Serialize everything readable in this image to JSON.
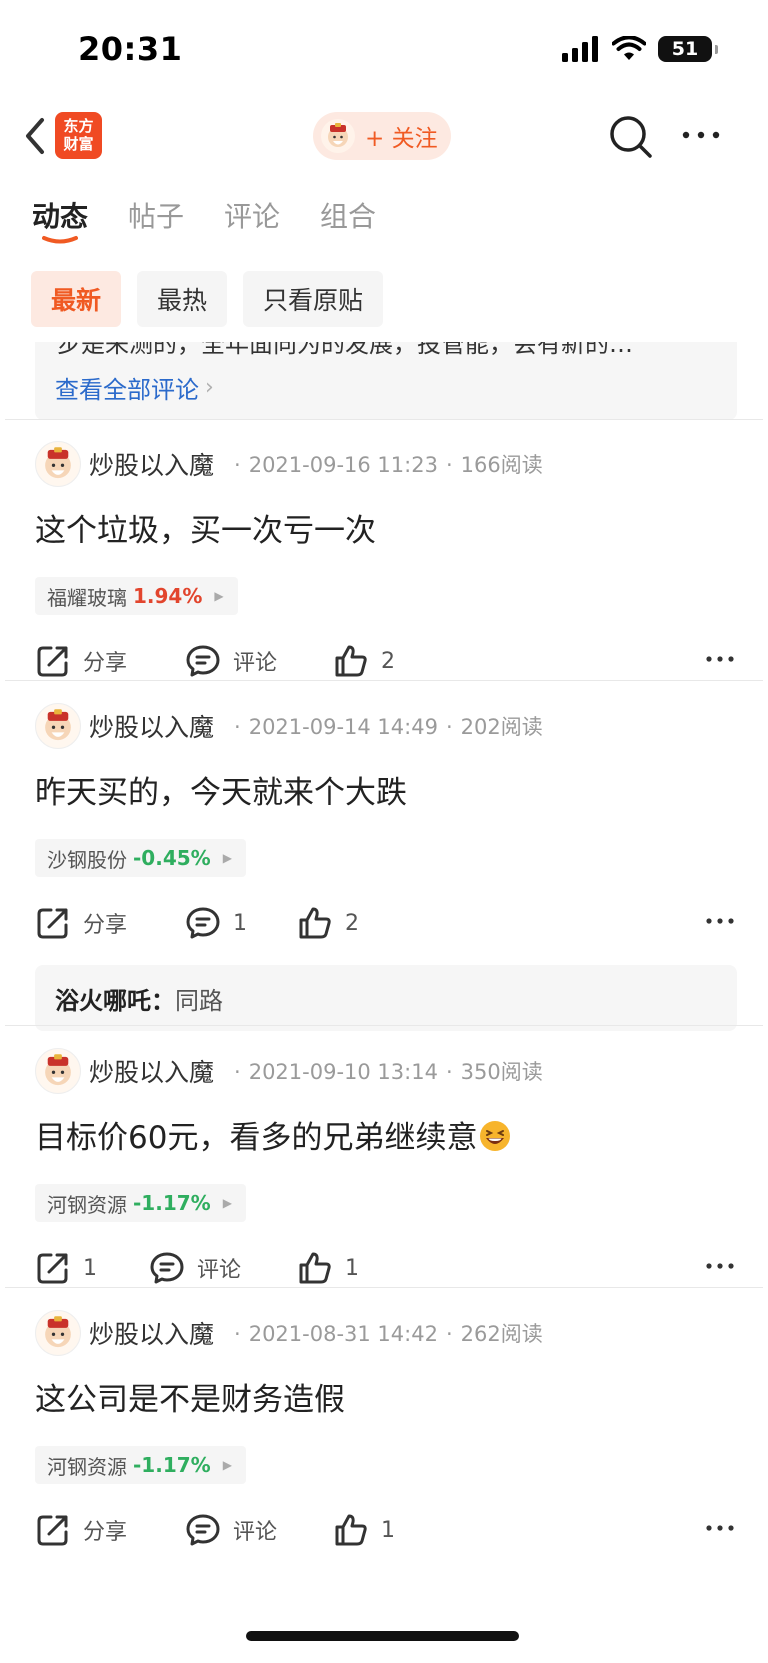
{
  "status_bar": {
    "time": "20:31",
    "battery": "51"
  },
  "nav": {
    "logo_text": "东方\n财富",
    "follow_label": "+ 关注"
  },
  "tabs": [
    {
      "label": "动态",
      "active": true
    },
    {
      "label": "帖子",
      "active": false
    },
    {
      "label": "评论",
      "active": false
    },
    {
      "label": "组合",
      "active": false
    }
  ],
  "filters": [
    {
      "label": "最新",
      "active": true
    },
    {
      "label": "最热",
      "active": false
    },
    {
      "label": "只看原贴",
      "active": false
    }
  ],
  "prev_comment": {
    "cut_text": "步是来测的，全年面向为的发展，投管能，会有新的…",
    "view_all": "查看全部评论"
  },
  "posts": [
    {
      "author": "炒股以入魔",
      "date": "2021-09-16 11:23",
      "reads": "166阅读",
      "text": "这个垃圾，买一次亏一次",
      "stock": {
        "name": "福耀玻璃",
        "change": "1.94%",
        "direction": "up"
      },
      "share": "分享",
      "comment": "评论",
      "like": "2",
      "reply": null
    },
    {
      "author": "炒股以入魔",
      "date": "2021-09-14 14:49",
      "reads": "202阅读",
      "text": "昨天买的，今天就来个大跌",
      "stock": {
        "name": "沙钢股份",
        "change": "-0.45%",
        "direction": "down"
      },
      "share": "分享",
      "comment": "1",
      "like": "2",
      "reply": {
        "author": "浴火哪吒：",
        "text": "同路"
      }
    },
    {
      "author": "炒股以入魔",
      "date": "2021-09-10 13:14",
      "reads": "350阅读",
      "text": "目标价60元，看多的兄弟继续意",
      "stock": {
        "name": "河钢资源",
        "change": "-1.17%",
        "direction": "down"
      },
      "share": "1",
      "comment": "评论",
      "like": "1",
      "reply": null
    },
    {
      "author": "炒股以入魔",
      "date": "2021-08-31 14:42",
      "reads": "262阅读",
      "text": "这公司是不是财务造假",
      "stock": {
        "name": "河钢资源",
        "change": "-1.17%",
        "direction": "down"
      },
      "share": "分享",
      "comment": "评论",
      "like": "1",
      "reply": null
    }
  ],
  "colors": {
    "accent": "#f05a23",
    "up": "#e2452d",
    "down": "#2fae5f",
    "link": "#2b6acb"
  }
}
